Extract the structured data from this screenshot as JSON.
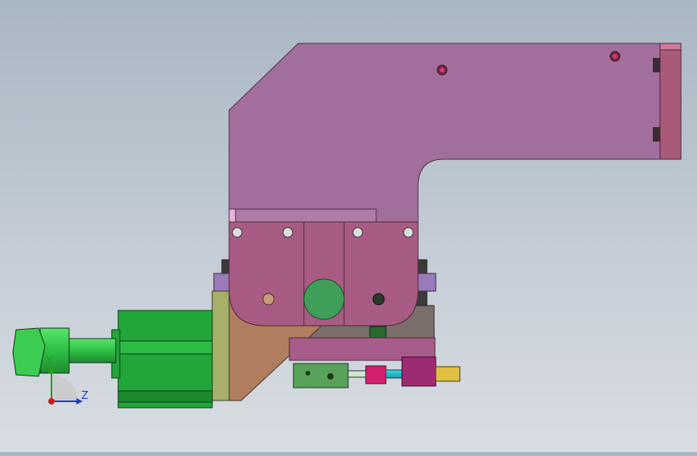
{
  "scene": {
    "triad": {
      "y_label": "Y",
      "z_label": "Z"
    },
    "colors": {
      "bracket": "#a26e9c",
      "bracket_dark": "#8f5a86",
      "end_plate": "#a95a78",
      "clamp_block": "#a85c84",
      "motor_green": "#22a63a",
      "motor_light": "#34cc48",
      "fixing_plate": "#a7b06a",
      "wedge": "#b07d5f",
      "cylinder": "#9d2b74"
    }
  }
}
